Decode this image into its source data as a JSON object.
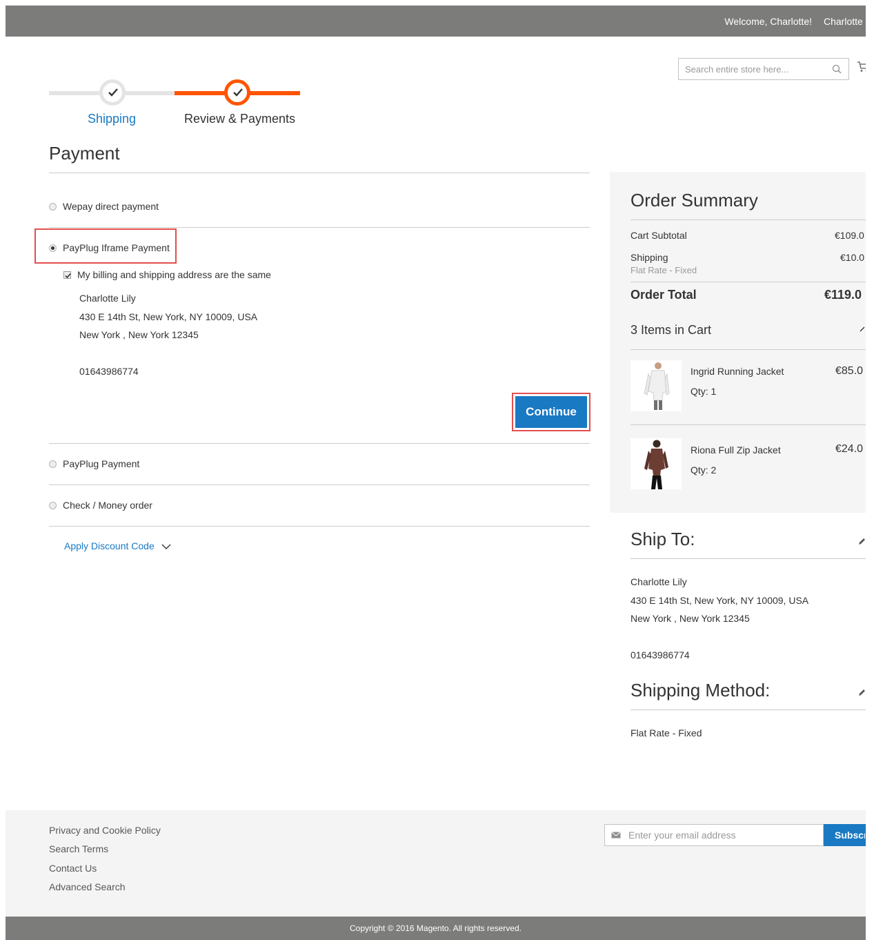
{
  "header": {
    "welcome": "Welcome, Charlotte!",
    "user": "Charlotte",
    "search_placeholder": "Search entire store here..."
  },
  "progress": {
    "steps": [
      {
        "label": "Shipping"
      },
      {
        "label": "Review & Payments"
      }
    ]
  },
  "payment": {
    "title": "Payment",
    "methods": [
      {
        "label": "Wepay direct payment"
      },
      {
        "label": "PayPlug Iframe Payment"
      },
      {
        "label": "PayPlug Payment"
      },
      {
        "label": "Check / Money order"
      }
    ],
    "selected_method": "PayPlug Iframe Payment",
    "billing_same_label": "My billing and shipping address are the same",
    "address": {
      "name": "Charlotte Lily",
      "street": "430 E 14th St, New York, NY 10009, USA",
      "city": "New York , New York 12345",
      "phone": "01643986774"
    },
    "continue_label": "Continue",
    "discount_label": "Apply Discount Code"
  },
  "summary": {
    "title": "Order Summary",
    "cart_subtotal_label": "Cart Subtotal",
    "cart_subtotal_value": "€109.0",
    "shipping_label": "Shipping",
    "shipping_value": "€10.0",
    "shipping_method": "Flat Rate - Fixed",
    "order_total_label": "Order Total",
    "order_total_value": "€119.0",
    "items_in_cart": "3 Items in Cart",
    "items": [
      {
        "name": "Ingrid Running Jacket",
        "qty": "Qty: 1",
        "price": "€85.0"
      },
      {
        "name": "Riona Full Zip Jacket",
        "qty": "Qty: 2",
        "price": "€24.0"
      }
    ]
  },
  "ship_to": {
    "title": "Ship To:",
    "name": "Charlotte Lily",
    "street": "430 E 14th St, New York, NY 10009, USA",
    "city": "New York , New York 12345",
    "phone": "01643986774"
  },
  "shipping_method": {
    "title": "Shipping Method:",
    "value": "Flat Rate - Fixed"
  },
  "footer": {
    "links": [
      "Privacy and Cookie Policy",
      "Search Terms",
      "Contact Us",
      "Advanced Search"
    ],
    "email_placeholder": "Enter your email address",
    "subscribe_label": "Subscribe",
    "copyright": "Copyright © 2016 Magento. All rights reserved."
  },
  "colors": {
    "accent": "#1979c3",
    "progress": "#ff5501",
    "header_bar": "#7c7d7a",
    "highlight_box": "#e24e4e"
  }
}
